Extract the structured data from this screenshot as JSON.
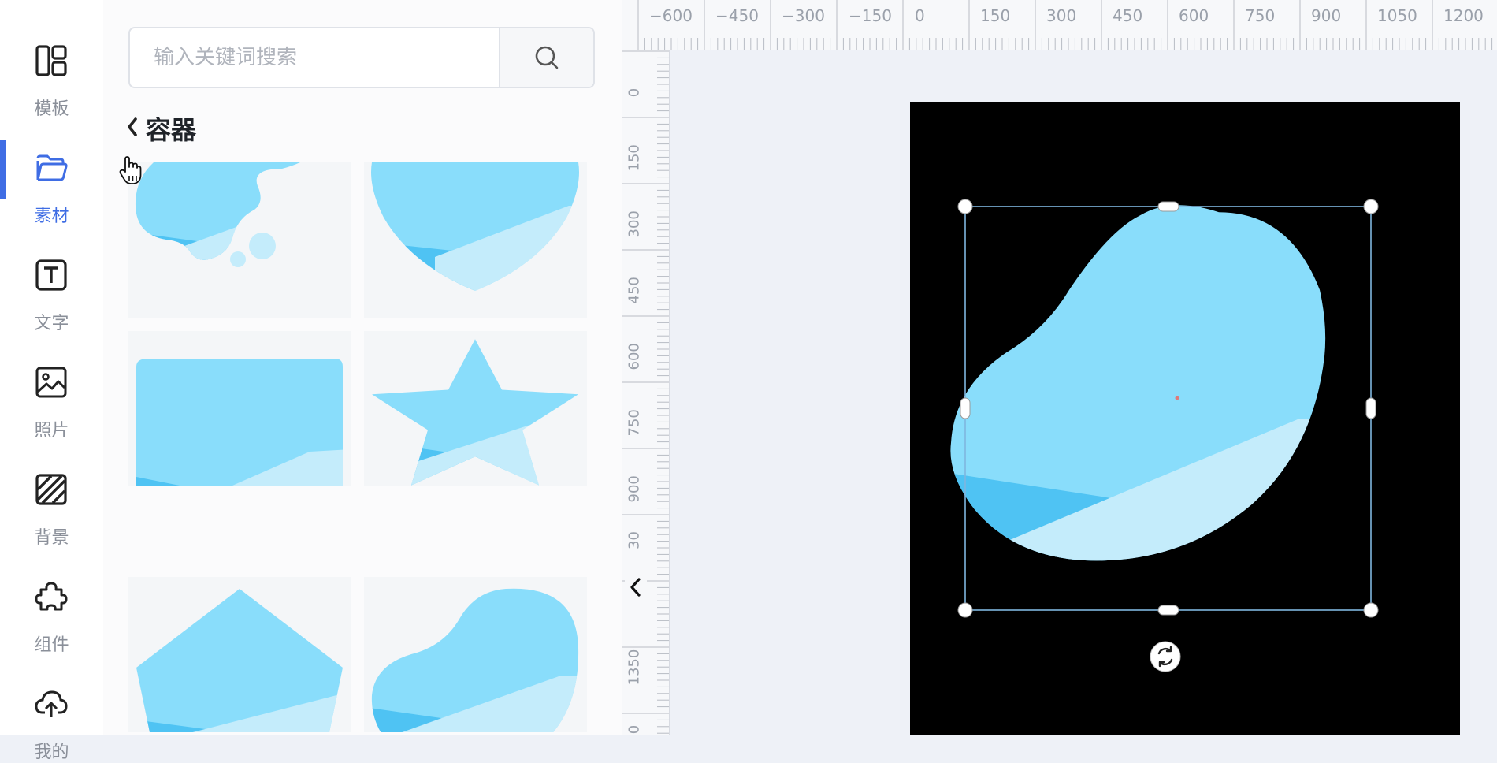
{
  "nav": {
    "items": [
      {
        "label": "模板",
        "icon": "layout-icon"
      },
      {
        "label": "素材",
        "icon": "folder-icon"
      },
      {
        "label": "文字",
        "icon": "text-icon"
      },
      {
        "label": "照片",
        "icon": "image-icon"
      },
      {
        "label": "背景",
        "icon": "background-icon"
      },
      {
        "label": "组件",
        "icon": "puzzle-icon"
      },
      {
        "label": "我的",
        "icon": "upload-cloud-icon"
      }
    ],
    "active": "素材"
  },
  "search": {
    "placeholder": "输入关键词搜索",
    "value": ""
  },
  "section": {
    "title": "容器"
  },
  "materials": [
    {
      "shape": "blob-with-dots"
    },
    {
      "shape": "heart"
    },
    {
      "shape": "speech-bubble"
    },
    {
      "shape": "star"
    },
    {
      "shape": "pentagon"
    },
    {
      "shape": "blob"
    }
  ],
  "rulers": {
    "horizontal": [
      "−600",
      "−450",
      "−300",
      "−150",
      "0",
      "150",
      "300",
      "450",
      "600",
      "750",
      "900",
      "1050",
      "1200"
    ],
    "vertical": [
      "0",
      "150",
      "300",
      "450",
      "600",
      "750",
      "900",
      "30",
      "1350",
      "0"
    ]
  },
  "canvas": {
    "background": "#000000",
    "selected_element": "blob-container"
  },
  "colors": {
    "accent": "#3f6de4",
    "shape_light": "#89ddfb",
    "shape_pale": "#c4ecfb",
    "shape_deep": "#4fc3f3",
    "selection": "#7fb6df"
  }
}
